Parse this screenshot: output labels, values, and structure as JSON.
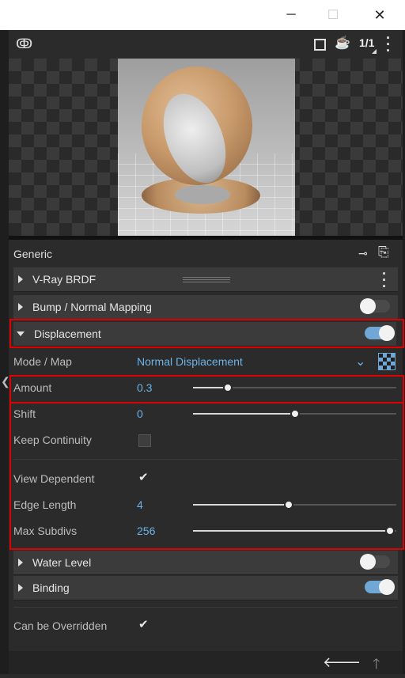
{
  "titlebar": {
    "minimize": "─",
    "maximize": "☐",
    "close": "✕"
  },
  "toolbar": {
    "ratio": "1/1"
  },
  "panel": {
    "title": "Generic"
  },
  "rollouts": {
    "brdf": "V-Ray BRDF",
    "bump": "Bump / Normal Mapping",
    "displacement": "Displacement",
    "water": "Water Level",
    "binding": "Binding"
  },
  "params": {
    "mode": {
      "label": "Mode / Map",
      "value": "Normal Displacement"
    },
    "amount": {
      "label": "Amount",
      "value": "0.3",
      "level": 0.17
    },
    "shift": {
      "label": "Shift",
      "value": "0",
      "level": 0.5
    },
    "keep_continuity": {
      "label": "Keep Continuity",
      "checked": false
    },
    "view_dependent": {
      "label": "View Dependent",
      "checked": true
    },
    "edge_length": {
      "label": "Edge Length",
      "value": "4",
      "level": 0.47
    },
    "max_subdivs": {
      "label": "Max Subdivs",
      "value": "256",
      "level": 0.97
    }
  },
  "overrides": {
    "label": "Can be Overridden",
    "checked": true
  },
  "toggles": {
    "bump": false,
    "displacement": true,
    "water": false,
    "binding": true
  },
  "colors": {
    "accent": "#6fa8d6",
    "value_text": "#6cb3e8",
    "highlight": "#e00000"
  }
}
